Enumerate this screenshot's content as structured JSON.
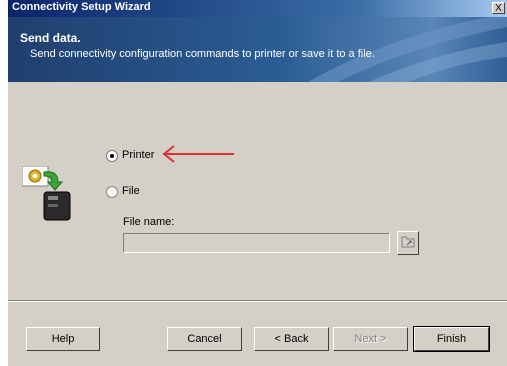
{
  "window": {
    "title": "Connectivity Setup Wizard",
    "close_label": "X"
  },
  "header": {
    "title": "Send data.",
    "subtitle": "Send connectivity configuration commands to printer or save it to a file."
  },
  "options": {
    "printer_label": "Printer",
    "file_label": "File",
    "selected": "Printer"
  },
  "file": {
    "name_label": "File name:",
    "name_value": ""
  },
  "buttons": {
    "help": "Help",
    "cancel": "Cancel",
    "back": "< Back",
    "next": "Next >",
    "finish": "Finish"
  },
  "icons": {
    "wizard_icon": "printer-gear-icon",
    "browse_icon": "folder-browse-icon",
    "annotation": "red-arrow-icon"
  },
  "colors": {
    "annotation_arrow": "#e03030",
    "header_bg": "#2b5d95",
    "dialog_bg": "#d4d0c8"
  }
}
